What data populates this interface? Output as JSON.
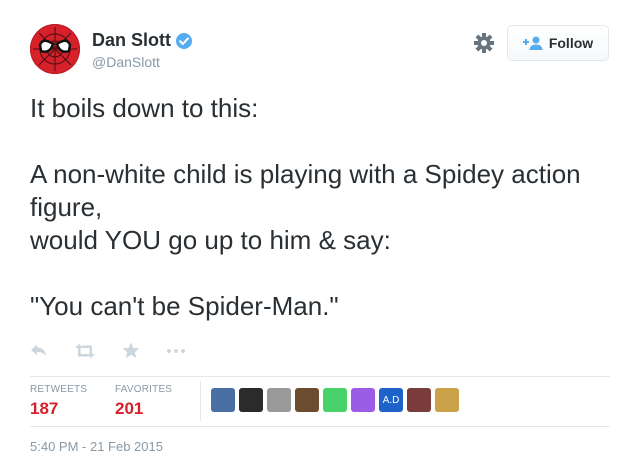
{
  "user": {
    "display_name": "Dan Slott",
    "handle": "@DanSlott",
    "avatar_icon": "spider-man-mask-icon",
    "verified_icon": "verified-badge-icon",
    "verified_color": "#55acee"
  },
  "follow_button": {
    "label": "Follow",
    "icon": "add-user-icon",
    "icon_color": "#55acee"
  },
  "settings_icon": "gear-icon",
  "tweet": {
    "text": "It boils down to this:\n\nA non-white child is playing with a Spidey action figure,\nwould YOU go up to him & say:\n\n\"You can't be Spider-Man.\""
  },
  "actions": [
    {
      "icon": "reply-icon"
    },
    {
      "icon": "retweet-icon"
    },
    {
      "icon": "favorite-star-icon"
    },
    {
      "icon": "more-icon"
    }
  ],
  "stats": {
    "retweets_label": "RETWEETS",
    "retweets_count": "187",
    "favorites_label": "FAVORITES",
    "favorites_count": "201",
    "count_color": "#d6202a"
  },
  "favoriters": [
    {
      "icon": "favoriter-avatar-icon",
      "color": "#4a6fa5"
    },
    {
      "icon": "favoriter-avatar-icon",
      "color": "#2b2b2b"
    },
    {
      "icon": "favoriter-avatar-icon",
      "color": "#9a9a9a"
    },
    {
      "icon": "favoriter-avatar-icon",
      "color": "#6b4c2f"
    },
    {
      "icon": "favoriter-avatar-icon",
      "color": "#47d36a"
    },
    {
      "icon": "favoriter-avatar-icon",
      "color": "#9b5de5"
    },
    {
      "icon": "favoriter-avatar-icon",
      "color": "#1d63c9",
      "text": "A.D"
    },
    {
      "icon": "favoriter-avatar-icon",
      "color": "#7a3b3b"
    },
    {
      "icon": "favoriter-avatar-icon",
      "color": "#c9a24a"
    }
  ],
  "timestamp": "5:40 PM - 21 Feb 2015"
}
